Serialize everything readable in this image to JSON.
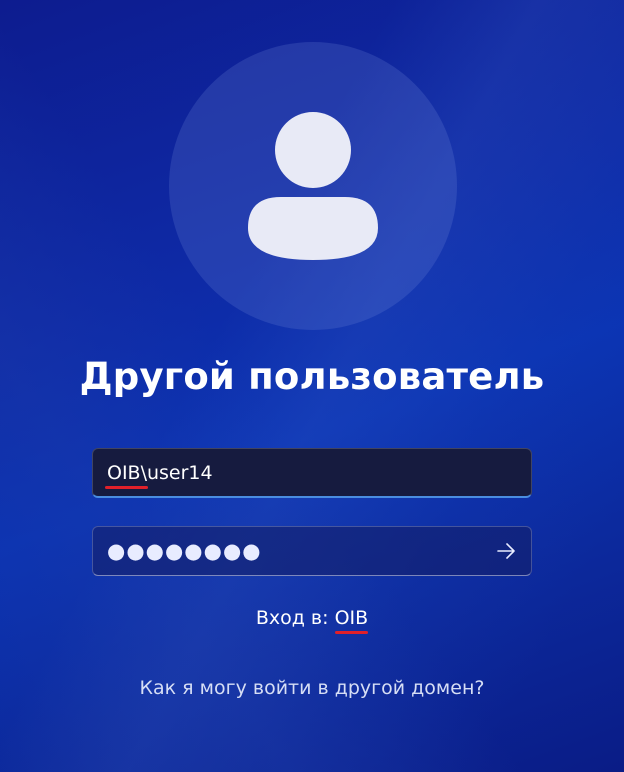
{
  "login": {
    "title": "Другой пользователь",
    "username_value": "OIB\\user14",
    "username_domain_part": "OIB",
    "password_mask": "●●●●●●●●",
    "submit_icon": "arrow-right-icon",
    "sign_in_label": "Вход в:",
    "sign_in_domain": "OIB",
    "other_domain_link": "Как я могу войти в другой домен?"
  },
  "colors": {
    "background": "#0a1e9c",
    "annotation_underline": "#e0202a",
    "focus_underline": "#4a8de0"
  },
  "icons": {
    "avatar": "user-silhouette-icon"
  }
}
